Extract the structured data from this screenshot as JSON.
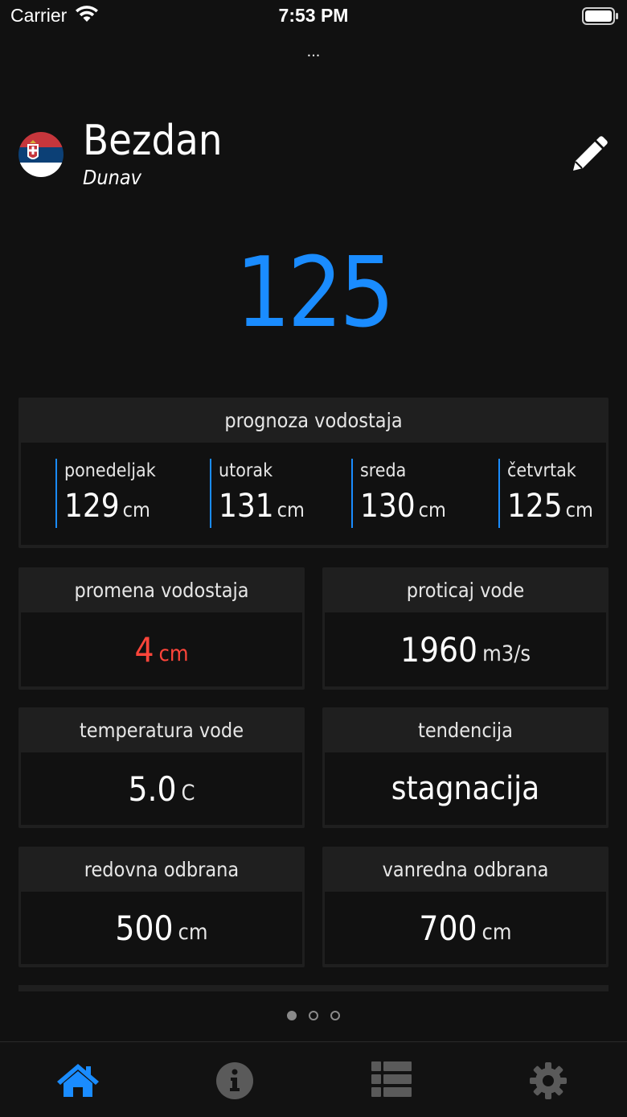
{
  "status_bar": {
    "carrier": "Carrier",
    "time": "7:53 PM"
  },
  "top": {
    "more": "..."
  },
  "header": {
    "station": "Bezdan",
    "river": "Dunav"
  },
  "current_level": "125",
  "forecast": {
    "title": "prognoza vodostaja",
    "days": [
      {
        "day": "ponedeljak",
        "value": "129",
        "unit": "cm"
      },
      {
        "day": "utorak",
        "value": "131",
        "unit": "cm"
      },
      {
        "day": "sreda",
        "value": "130",
        "unit": "cm"
      },
      {
        "day": "četvrtak",
        "value": "125",
        "unit": "cm"
      }
    ]
  },
  "cards": {
    "level_change": {
      "title": "promena vodostaja",
      "value": "4",
      "unit": "cm"
    },
    "flow": {
      "title": "proticaj vode",
      "value": "1960",
      "unit": "m3/s"
    },
    "water_temp": {
      "title": "temperatura vode",
      "value": "5.0",
      "unit": "C"
    },
    "trend": {
      "title": "tendencija",
      "value": "stagnacija"
    },
    "regular_defense": {
      "title": "redovna odbrana",
      "value": "500",
      "unit": "cm"
    },
    "emergency_defense": {
      "title": "vanredna odbrana",
      "value": "700",
      "unit": "cm"
    }
  },
  "pager": {
    "pages": 3,
    "active": 1
  },
  "tabs": [
    {
      "name": "home",
      "active": true
    },
    {
      "name": "info",
      "active": false
    },
    {
      "name": "list",
      "active": false
    },
    {
      "name": "settings",
      "active": false
    }
  ],
  "colors": {
    "accent": "#1a8cff",
    "negative": "#ff453a",
    "background": "#111111",
    "card": "#1f1f1f",
    "inactive_icon": "#5a5a5a"
  }
}
